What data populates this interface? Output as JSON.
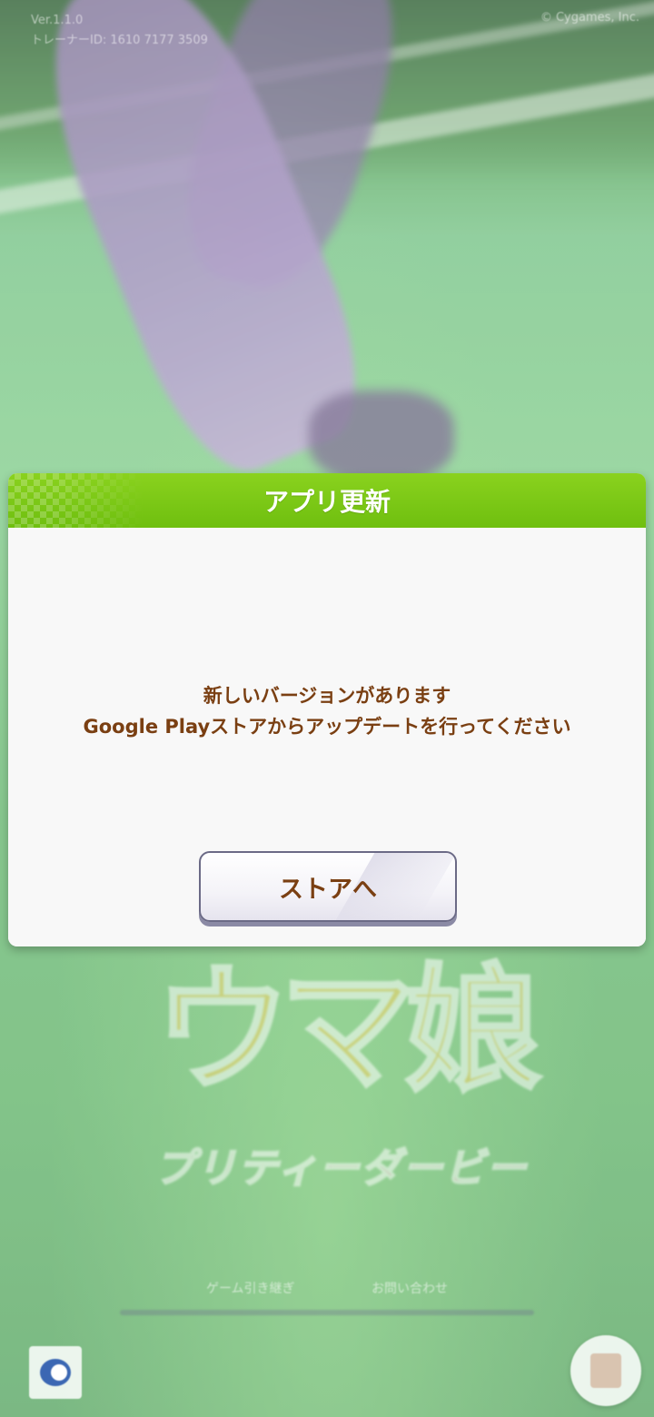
{
  "background": {
    "version_text": "Ver.1.1.0",
    "trainer_id_text": "トレーナーID: 1610 7177 3509",
    "copyright": "© Cygames, Inc."
  },
  "logo": {
    "main_text": "ウマ娘",
    "sub_text": "プリティーダービー"
  },
  "footer": {
    "links": [
      "ゲーム引き継ぎ",
      "お問い合わせ"
    ]
  },
  "dialog": {
    "title": "アプリ更新",
    "message_line1": "新しいバージョンがあります",
    "message_line2": "Google Playストアからアップデートを行ってください",
    "store_button_label": "ストアへ"
  },
  "colors": {
    "header_green": "#7cc917",
    "text_brown": "#7a3f12",
    "button_border": "#6b6a86"
  },
  "icons": [
    "cygames-icon",
    "menu-icon"
  ]
}
